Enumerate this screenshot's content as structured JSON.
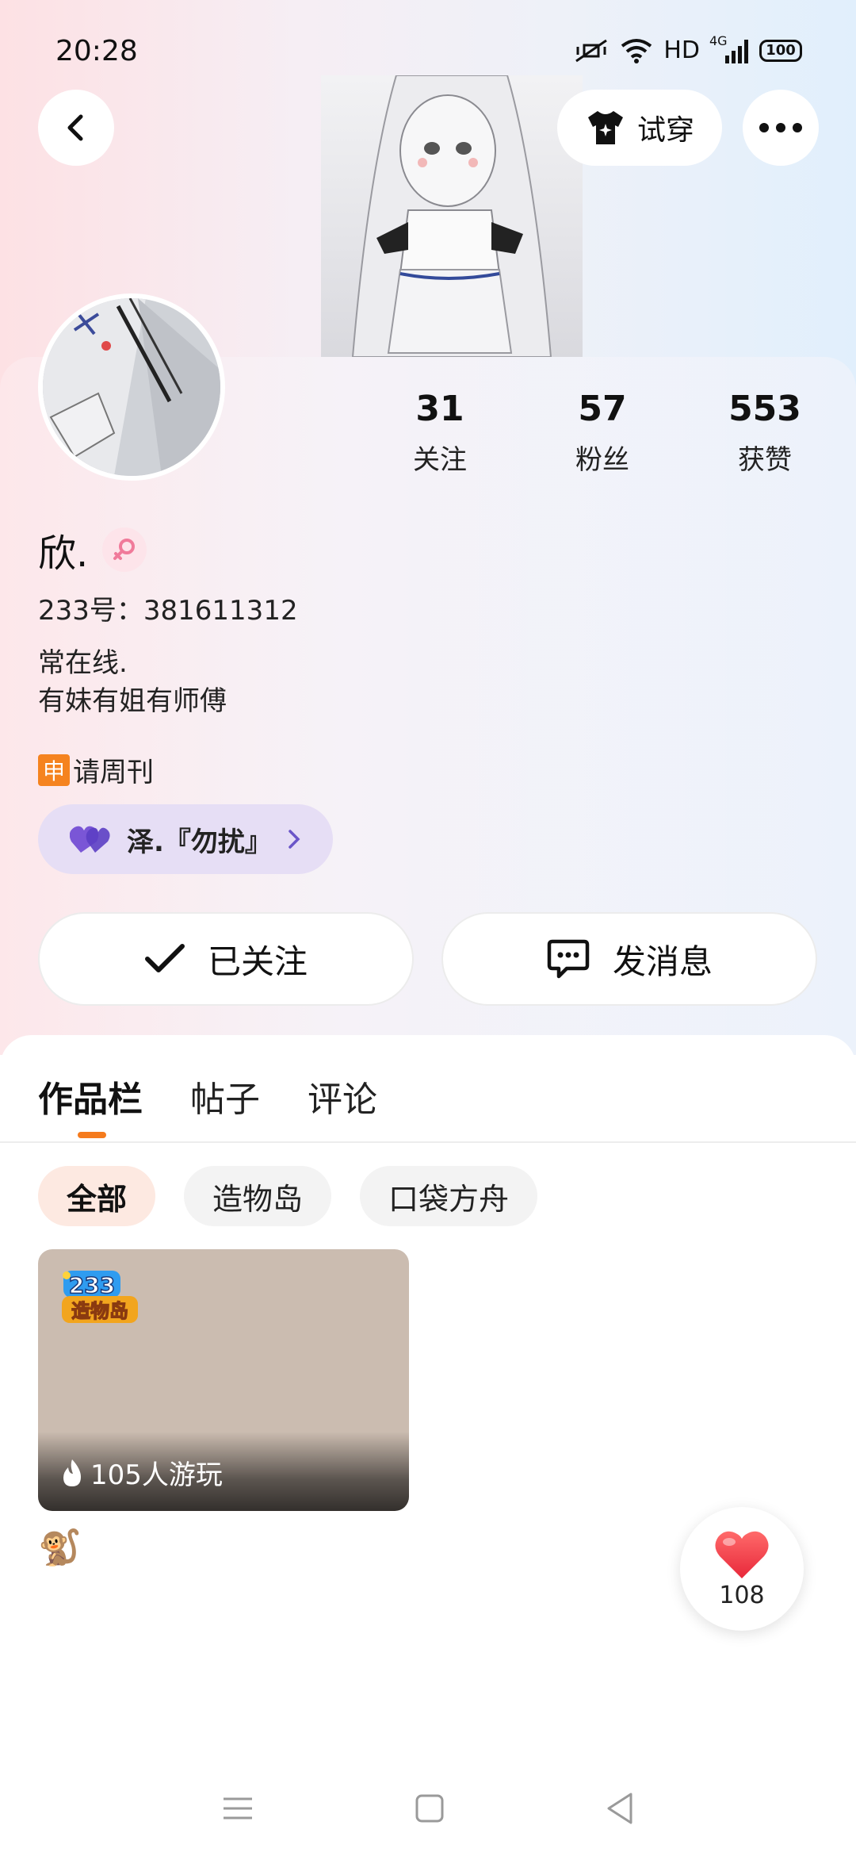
{
  "status_bar": {
    "time": "20:28",
    "network_label": "HD",
    "signal_label": "4G",
    "battery": "100"
  },
  "header": {
    "tryon_label": "试穿"
  },
  "profile": {
    "stats": [
      {
        "value": "31",
        "label": "关注"
      },
      {
        "value": "57",
        "label": "粉丝"
      },
      {
        "value": "553",
        "label": "获赞"
      }
    ],
    "username": "欣.",
    "user_id": "233号：381611312",
    "bio_line1": "常在线.",
    "bio_line2": "有妹有姐有师傅",
    "weekly_badge": "申",
    "weekly_label": "请周刊",
    "cp_name": "泽.『勿扰』",
    "follow_label": "已关注",
    "message_label": "发消息"
  },
  "content": {
    "tabs": [
      "作品栏",
      "帖子",
      "评论"
    ],
    "filters": [
      "全部",
      "造物岛",
      "口袋方舟"
    ],
    "game_card": {
      "logo_text_top": "233",
      "logo_text_bottom": "造物岛",
      "plays": "105人游玩"
    }
  },
  "like_fab": {
    "count": "108"
  },
  "colors": {
    "accent": "#f57b1d",
    "cp_chip_bg": "#e6def5",
    "heart": "#f43c4c"
  }
}
